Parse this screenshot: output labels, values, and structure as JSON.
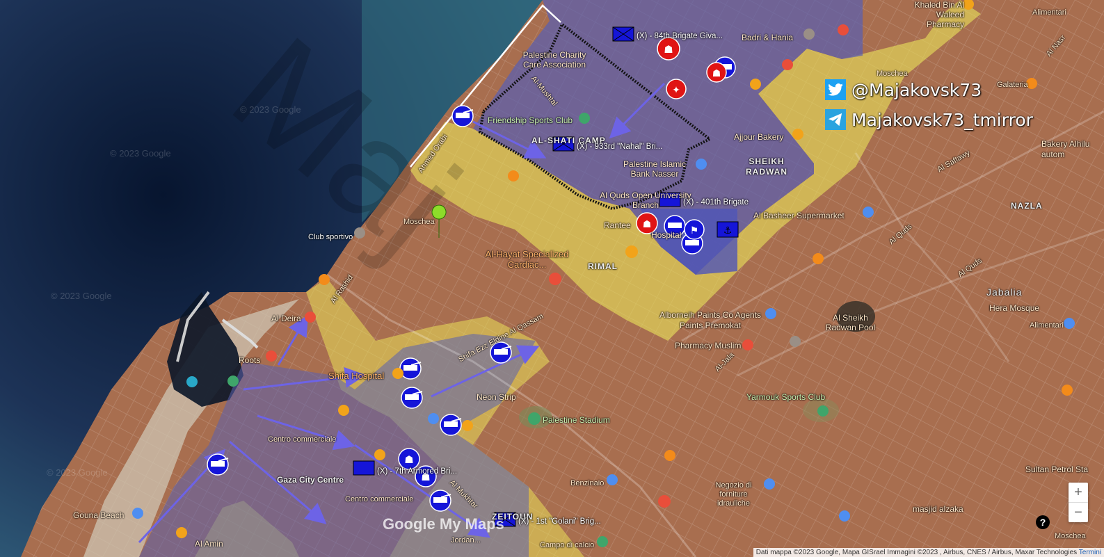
{
  "social": {
    "twitter": "@Majakovsk73",
    "telegram": "Majakovsk73_tmirror"
  },
  "watermark": "© 2023 Google",
  "place_labels": {
    "sheikh_radwan": "SHEIKH RADWAN",
    "nazla": "NAZLA",
    "rimal": "RIMAL",
    "jabalia": "Jabalia",
    "al_shati_camp": "AL-SHATI CAMP",
    "gaza_city_centre": "Gaza City Centre",
    "zeitoun": "ZEITOUN"
  },
  "poi_labels": {
    "khaled_bin_al_waleed": "Khaled Bin Al Waleed Pharmacy",
    "badri_hania": "Badri & Hania",
    "palestine_charity": "Palestine Charity Care Association",
    "friendship_sports": "Friendship Sports Club",
    "ajjour_bakery": "Ajjour Bakery",
    "palestine_islamic_bank": "Palestine Islamic Bank Nasser",
    "al_quds_open_univ": "Al Quds Open University Branch",
    "al_basheer": "Al Basheer Supermarket",
    "al_hayat": "Al-Hayat Specialized Cardiac...",
    "club_sportivo": "Club sportivo",
    "moschea": "Moschea",
    "al_deira": "Al Deira",
    "roots": "Roots",
    "shifa_hospital": "Shifa Hospital",
    "neon_strip": "Neon Strip",
    "palestine_stadium": "Palestine Stadium",
    "alborneih": "Alborneih Paints Co Agents Paints Premokat",
    "pharmacy_muslim": "Pharmacy Muslim",
    "yarmouk_sports": "Yarmouk Sports Club",
    "al_sheikh_radwan_pool": "Al Sheikh Radwan Pool",
    "hera_mosque": "Hera Mosque",
    "centro_commerciale_1": "Centro commerciale",
    "centro_commerciale_2": "Centro commerciale",
    "gouna_beach": "Gouna Beach",
    "al_amin": "Al Amin",
    "benzinaio": "Benzinaio",
    "negozio": "Negozio di forniture idrauliche",
    "sultan_petrol": "Sultan Petrol Sta",
    "masjid_alzaka": "masjid alzaka",
    "campo_calcio": "Campo di calcio",
    "jordan": "Jordan...",
    "bakery_alhilu": "Bakery Alhilu autom",
    "galateria": "Galateria",
    "moschea_2": "Moschea",
    "moschea_3": "Moschea",
    "alimentari": "Alimentari",
    "alimentari_2": "Alimentari",
    "rantee": "Rantee",
    "hospital_short": "Hospital"
  },
  "street_labels": {
    "al_rashid": "Al Rashid",
    "shifa_ezz_eldine": "Shifa Ezz Eldine Al Qassam",
    "al_jala": "Al-Jala",
    "al_quds": "Al Quds",
    "al_quds_2": "Al Quds",
    "al_saftawy": "Al Saftawy",
    "al_nasr": "Al Nasr",
    "al_mushtal": "Al-Mushtal",
    "al_mukhtar": "Al Mukhtar",
    "ahmed_orabi": "Ahmed Orabi"
  },
  "units": {
    "u84": "(X) - 84th Brigate Giva...",
    "u933": "(X) - 933rd \"Nahal\" Bri...",
    "u401": "(X) - 401th Brigate",
    "u7": "(X) - 7th Armored Bri...",
    "u1": "(X) - 1st \"Golani\" Brig..."
  },
  "controls": {
    "zoom_in": "+",
    "zoom_out": "−",
    "help": "?"
  },
  "branding": "Google My Maps",
  "attribution": {
    "text": "Dati mappa ©2023 Google, Mapa GISrael Immagini ©2023 , Airbus, CNES / Airbus, Maxar Technologies",
    "link": "Termini"
  },
  "colors": {
    "sea": "#1b2c4e",
    "land": "#a86e4f",
    "yellow_zone": "#e9e05a",
    "blue_zone": "#6a6fae",
    "unit_blue": "#1515d8",
    "red_unit": "#e01414",
    "arrow": "#6d63e6"
  }
}
